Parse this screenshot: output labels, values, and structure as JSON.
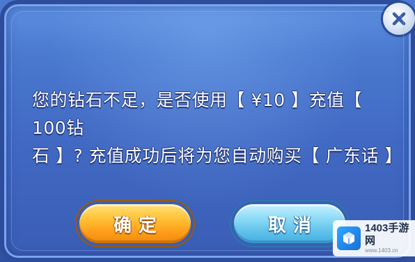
{
  "dialog": {
    "message_line1": "您的钻石不足，是否使用【 ¥10 】充值【 100钻",
    "message_line2": "石 】? 充值成功后将为您自动购买【 广东话 】",
    "confirm_label": "确定",
    "cancel_label": "取消",
    "close_icon": "close-icon"
  },
  "watermark": {
    "title": "1403手游网",
    "subtitle": "www.1403.cn",
    "logo_icon": "cube-icon"
  },
  "colors": {
    "panel": "#4169c3",
    "confirm": "#ffb12b",
    "cancel": "#6cc8ee",
    "text": "#ffffff"
  }
}
